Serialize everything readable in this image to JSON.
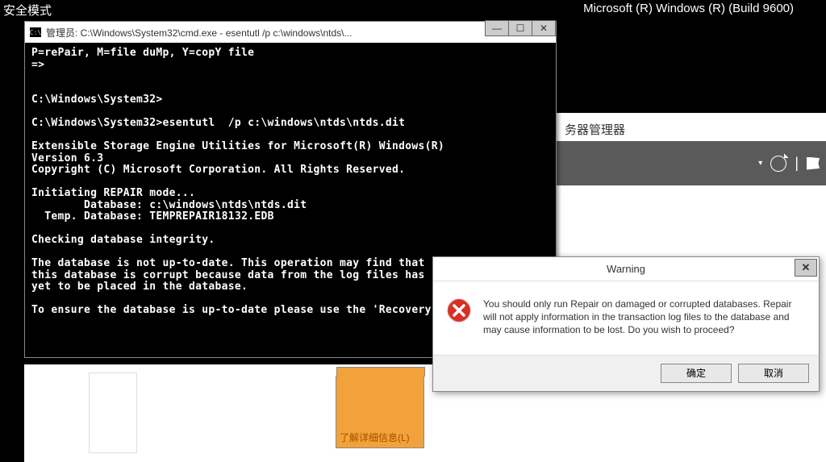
{
  "safe_mode": "安全模式",
  "build_info": "Microsoft (R) Windows (R) (Build 9600)",
  "server_manager_title": "务器管理器",
  "orange_tile_label": "了解详细信息(L)",
  "cmd": {
    "title": "管理员: C:\\Windows\\System32\\cmd.exe - esentutl  /p c:\\windows\\ntds\\...",
    "output": "P=rePair, M=file duMp, Y=copY file\n=>\n\n\nC:\\Windows\\System32>\n\nC:\\Windows\\System32>esentutl  /p c:\\windows\\ntds\\ntds.dit\n\nExtensible Storage Engine Utilities for Microsoft(R) Windows(R)\nVersion 6.3\nCopyright (C) Microsoft Corporation. All Rights Reserved.\n\nInitiating REPAIR mode...\n        Database: c:\\windows\\ntds\\ntds.dit\n  Temp. Database: TEMPREPAIR18132.EDB\n\nChecking database integrity.\n\nThe database is not up-to-date. This operation may find that\nthis database is corrupt because data from the log files has\nyet to be placed in the database.\n\nTo ensure the database is up-to-date please use the 'Recovery'\n\n\n"
  },
  "warning": {
    "title": "Warning",
    "message": "You should only run Repair on damaged or corrupted databases. Repair will not apply information in the transaction log files to the database and may cause information to be lost. Do you wish to proceed?",
    "ok": "确定",
    "cancel": "取消"
  }
}
